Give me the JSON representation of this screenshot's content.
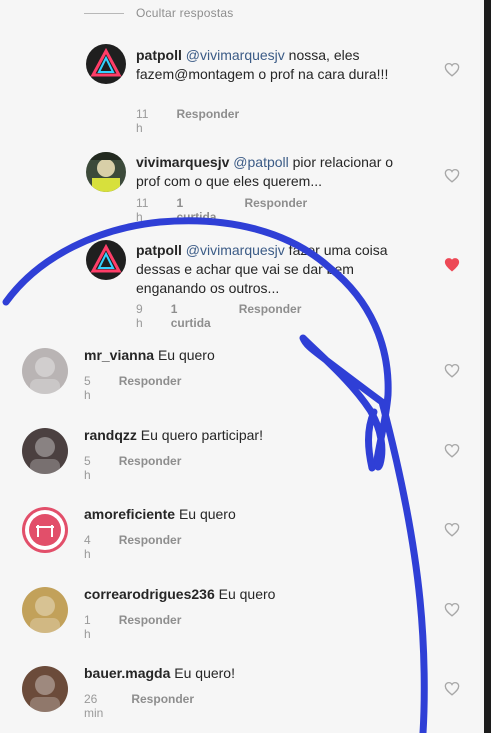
{
  "hide_replies": "Ocultar respostas",
  "replies": [
    {
      "user": "patpoll",
      "mention": "@vivimarquesjv",
      "text": " nossa, eles fazem@montagem o prof na cara dura!!!",
      "time": "11 h",
      "likes": "",
      "reply": "Responder",
      "liked": false,
      "avatar_color": "#1f1f1f"
    },
    {
      "user": "vivimarquesjv",
      "mention": "@patpoll",
      "text": " pior relacionar o prof com o que eles querem...",
      "time": "11 h",
      "likes": "1 curtida",
      "reply": "Responder",
      "liked": false,
      "avatar_color": "#3c4a3a"
    },
    {
      "user": "patpoll",
      "mention": "@vivimarquesjv",
      "text": " fazer uma coisa dessas e achar que vai se dar bem enganando os outros...",
      "time": "9 h",
      "likes": "1 curtida",
      "reply": "Responder",
      "liked": true,
      "avatar_color": "#1f1f1f"
    }
  ],
  "comments": [
    {
      "user": "mr_vianna",
      "text": "Eu quero",
      "time": "5 h",
      "reply": "Responder",
      "avatar_color": "#b9b4b4"
    },
    {
      "user": "randqzz",
      "text": "Eu quero participar!",
      "time": "5 h",
      "reply": "Responder",
      "avatar_color": "#4b4040"
    },
    {
      "user": "amoreficiente",
      "text": "Eu quero",
      "time": "4 h",
      "reply": "Responder",
      "avatar_color": "#e24f6a"
    },
    {
      "user": "correarodrigues236",
      "text": "Eu quero",
      "time": "1 h",
      "reply": "Responder",
      "avatar_color": "#c2a15a"
    },
    {
      "user": "bauer.magda",
      "text": "Eu quero!",
      "time": "26 min",
      "reply": "Responder",
      "avatar_color": "#6b4b3a"
    }
  ],
  "colors": {
    "liked_heart": "#ed4956",
    "annotation_scribble": "#2f3fd6"
  }
}
